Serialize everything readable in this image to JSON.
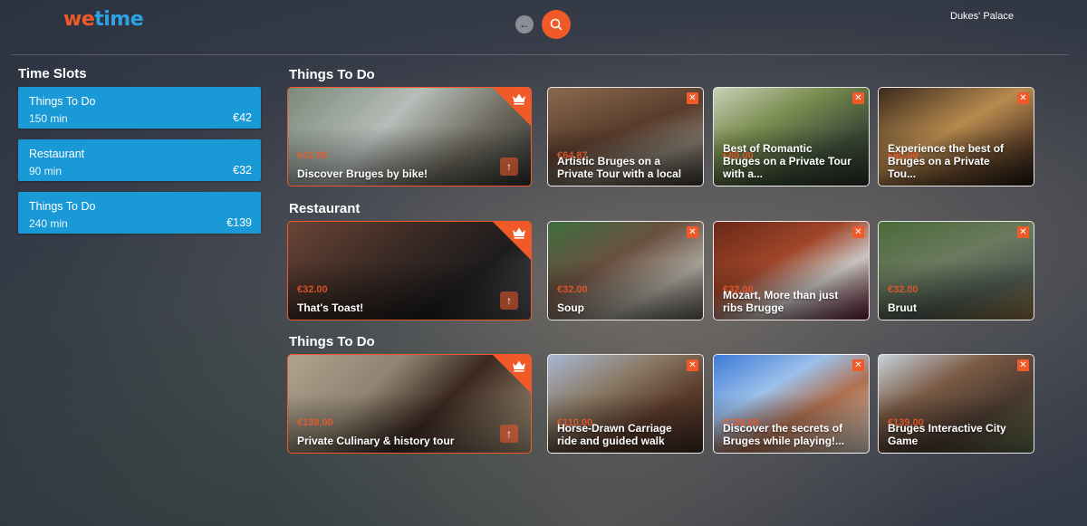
{
  "header": {
    "logo_we": "we",
    "logo_time": "time",
    "back_icon": "arrow-left-icon",
    "search_icon": "search-icon",
    "location": "Dukes' Palace"
  },
  "colors": {
    "accent": "#f05a28",
    "slot_blue": "#199ad6",
    "logo_blue": "#2ea3e3"
  },
  "sidebar": {
    "title": "Time Slots",
    "slots": [
      {
        "name": "Things To Do",
        "duration": "150 min",
        "price": "€42"
      },
      {
        "name": "Restaurant",
        "duration": "90 min",
        "price": "€32"
      },
      {
        "name": "Things To Do",
        "duration": "240 min",
        "price": "€139"
      }
    ]
  },
  "sections": [
    {
      "title": "Things To Do",
      "featured": {
        "price": "€42.00",
        "title": "Discover Bruges by bike!"
      },
      "cards": [
        {
          "price": "€64.87",
          "title": "Artistic Bruges on a Private Tour with a local"
        },
        {
          "price": "€80.00",
          "title": "Best of Romantic Bruges on a Private Tour with a..."
        },
        {
          "price": "€80.00",
          "title": "Experience the best of Bruges on a Private Tou..."
        }
      ]
    },
    {
      "title": "Restaurant",
      "featured": {
        "price": "€32.00",
        "title": "That's Toast!"
      },
      "cards": [
        {
          "price": "€32.00",
          "title": "Soup"
        },
        {
          "price": "€32.00",
          "title": "Mozart, More than just ribs Brugge"
        },
        {
          "price": "€32.00",
          "title": "Bruut"
        }
      ]
    },
    {
      "title": "Things To Do",
      "featured": {
        "price": "€139.00",
        "title": "Private Culinary & history tour"
      },
      "cards": [
        {
          "price": "€110.00",
          "title": "Horse-Drawn Carriage ride and guided walk"
        },
        {
          "price": "€139.00",
          "title": "Discover the secrets of Bruges while playing!..."
        },
        {
          "price": "€139.00",
          "title": "Bruges Interactive City Game"
        }
      ]
    }
  ]
}
